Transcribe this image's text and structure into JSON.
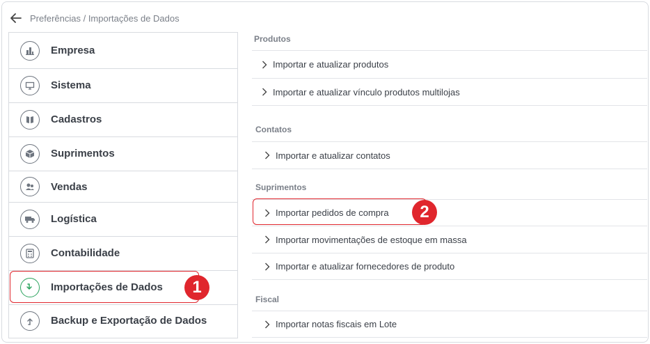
{
  "breadcrumb": {
    "text": "Preferências / Importações de Dados",
    "back_icon": "arrow-left-icon"
  },
  "menu": {
    "items": [
      {
        "label": "Empresa",
        "icon": "building-icon",
        "active": false
      },
      {
        "label": "Sistema",
        "icon": "monitor-icon",
        "active": false
      },
      {
        "label": "Cadastros",
        "icon": "book-icon",
        "active": false
      },
      {
        "label": "Suprimentos",
        "icon": "box-icon",
        "active": false
      },
      {
        "label": "Vendas",
        "icon": "users-icon",
        "active": false
      },
      {
        "label": "Logística",
        "icon": "truck-icon",
        "active": false
      },
      {
        "label": "Contabilidade",
        "icon": "calculator-icon",
        "active": false
      },
      {
        "label": "Importações de Dados",
        "icon": "import-icon",
        "active": true
      },
      {
        "label": "Backup e Exportação de Dados",
        "icon": "export-icon",
        "active": false
      }
    ]
  },
  "sections": {
    "produtos": {
      "title": "Produtos",
      "options": [
        "Importar e atualizar produtos",
        "Importar e atualizar vínculo produtos multilojas"
      ]
    },
    "contatos": {
      "title": "Contatos",
      "options": [
        "Importar e atualizar contatos"
      ]
    },
    "suprimentos": {
      "title": "Suprimentos",
      "options": [
        "Importar pedidos de compra",
        "Importar movimentações de estoque em massa",
        "Importar e atualizar fornecedores de produto"
      ]
    },
    "fiscal": {
      "title": "Fiscal",
      "options": [
        "Importar notas fiscais em Lote"
      ]
    }
  },
  "annotations": {
    "step1": "1",
    "step2": "2",
    "color": "#e0262d"
  },
  "colors": {
    "active_icon": "#2ba35e",
    "text": "#3a3f47",
    "muted": "#7b8089"
  }
}
